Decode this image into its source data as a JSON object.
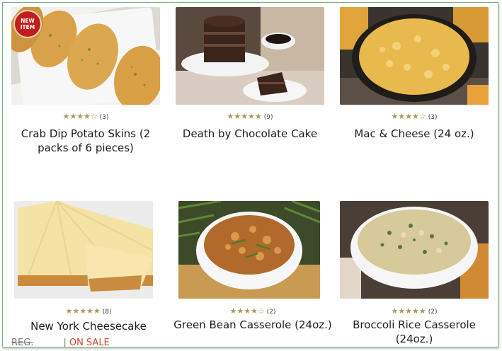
{
  "products": [
    {
      "name": "Crab Dip Potato Skins (2 packs of 6 pieces)",
      "rating": 4.5,
      "stars": "★★★★☆",
      "review_count": "(3)",
      "badge": "NEW ITEM"
    },
    {
      "name": "Death by Chocolate Cake",
      "rating": 5,
      "stars": "★★★★★",
      "review_count": "(9)"
    },
    {
      "name": "Mac & Cheese (24 oz.)",
      "rating": 4.5,
      "stars": "★★★★☆",
      "review_count": "(3)"
    },
    {
      "name": "New York Cheesecake",
      "rating": 5,
      "stars": "★★★★★",
      "review_count": "(8)"
    },
    {
      "name": "Green Bean Casserole (24oz.)",
      "rating": 4.5,
      "stars": "★★★★☆",
      "review_count": "(2)"
    },
    {
      "name": "Broccoli Rice Casserole (24oz.)",
      "rating": 5,
      "stars": "★★★★★",
      "review_count": "(2)"
    }
  ],
  "price_row": {
    "reg_label": "REG.",
    "separator": "|",
    "on_sale_label": "ON SALE"
  },
  "colors": {
    "star": "#a99a60",
    "badge": "#c21d1d",
    "on_sale": "#c9472f",
    "border": "#7fb07f"
  }
}
